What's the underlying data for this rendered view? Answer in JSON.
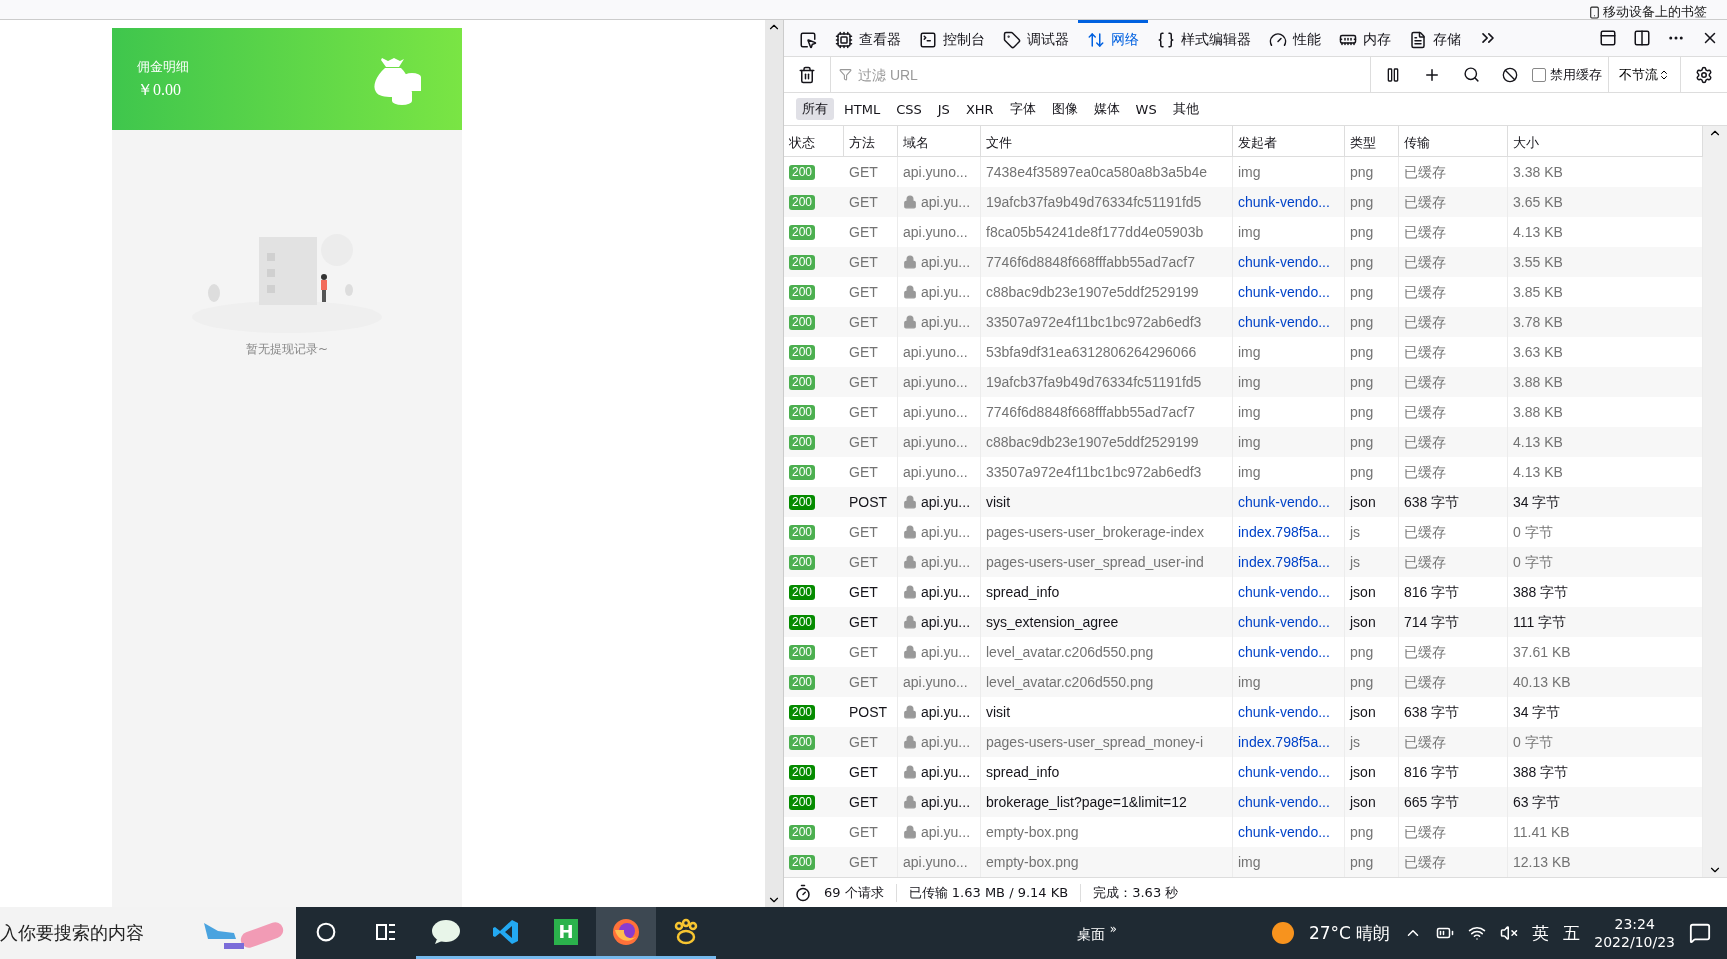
{
  "bookmarks_bar": {
    "label": "移动设备上的书签"
  },
  "mobile_page": {
    "header": {
      "title": "佣金明细",
      "amount": "￥0.00"
    },
    "empty_text": "暂无提现记录~"
  },
  "devtools": {
    "tabs": [
      {
        "kind": "picker",
        "selected": false
      },
      {
        "kind": "inspector",
        "label": "查看器",
        "selected": false
      },
      {
        "kind": "console",
        "label": "控制台",
        "selected": false
      },
      {
        "kind": "debugger",
        "label": "调试器",
        "selected": false
      },
      {
        "kind": "network",
        "label": "网络",
        "selected": true
      },
      {
        "kind": "style",
        "label": "样式编辑器",
        "selected": false
      },
      {
        "kind": "performance",
        "label": "性能",
        "selected": false
      },
      {
        "kind": "memory",
        "label": "内存",
        "selected": false
      },
      {
        "kind": "storage",
        "label": "存储",
        "selected": false
      }
    ],
    "filter": {
      "placeholder": "过滤 URL"
    },
    "disable_cache": {
      "label": "禁用缓存",
      "checked": false
    },
    "throttle": "不节流",
    "type_filters": [
      {
        "label": "所有",
        "selected": true
      },
      {
        "label": "HTML",
        "selected": false
      },
      {
        "label": "CSS",
        "selected": false
      },
      {
        "label": "JS",
        "selected": false
      },
      {
        "label": "XHR",
        "selected": false
      },
      {
        "label": "字体",
        "selected": false
      },
      {
        "label": "图像",
        "selected": false
      },
      {
        "label": "媒体",
        "selected": false
      },
      {
        "label": "WS",
        "selected": false
      },
      {
        "label": "其他",
        "selected": false
      }
    ],
    "columns": [
      "状态",
      "方法",
      "域名",
      "文件",
      "发起者",
      "类型",
      "传输",
      "大小"
    ],
    "rows": [
      {
        "status": "200",
        "method": "GET",
        "secure": false,
        "domain": "api.yuno...",
        "file": "7438e4f35897ea0ca580a8b3a5b4e",
        "initiator": "img",
        "initiator_link": false,
        "type": "png",
        "transfer": "已缓存",
        "size": "3.38 KB",
        "cached": true
      },
      {
        "status": "200",
        "method": "GET",
        "secure": true,
        "domain": "api.yu...",
        "file": "19afcb37fa9b49d76334fc51191fd5",
        "initiator": "chunk-vendo...",
        "initiator_link": true,
        "type": "png",
        "transfer": "已缓存",
        "size": "3.65 KB",
        "cached": true
      },
      {
        "status": "200",
        "method": "GET",
        "secure": false,
        "domain": "api.yuno...",
        "file": "f8ca05b54241de8f177dd4e05903b",
        "initiator": "img",
        "initiator_link": false,
        "type": "png",
        "transfer": "已缓存",
        "size": "4.13 KB",
        "cached": true
      },
      {
        "status": "200",
        "method": "GET",
        "secure": true,
        "domain": "api.yu...",
        "file": "7746f6d8848f668fffabb55ad7acf7",
        "initiator": "chunk-vendo...",
        "initiator_link": true,
        "type": "png",
        "transfer": "已缓存",
        "size": "3.55 KB",
        "cached": true
      },
      {
        "status": "200",
        "method": "GET",
        "secure": true,
        "domain": "api.yu...",
        "file": "c88bac9db23e1907e5ddf2529199",
        "initiator": "chunk-vendo...",
        "initiator_link": true,
        "type": "png",
        "transfer": "已缓存",
        "size": "3.85 KB",
        "cached": true
      },
      {
        "status": "200",
        "method": "GET",
        "secure": true,
        "domain": "api.yu...",
        "file": "33507a972e4f11bc1bc972ab6edf3",
        "initiator": "chunk-vendo...",
        "initiator_link": true,
        "type": "png",
        "transfer": "已缓存",
        "size": "3.78 KB",
        "cached": true
      },
      {
        "status": "200",
        "method": "GET",
        "secure": false,
        "domain": "api.yuno...",
        "file": "53bfa9df31ea6312806264296066",
        "initiator": "img",
        "initiator_link": false,
        "type": "png",
        "transfer": "已缓存",
        "size": "3.63 KB",
        "cached": true
      },
      {
        "status": "200",
        "method": "GET",
        "secure": false,
        "domain": "api.yuno...",
        "file": "19afcb37fa9b49d76334fc51191fd5",
        "initiator": "img",
        "initiator_link": false,
        "type": "png",
        "transfer": "已缓存",
        "size": "3.88 KB",
        "cached": true
      },
      {
        "status": "200",
        "method": "GET",
        "secure": false,
        "domain": "api.yuno...",
        "file": "7746f6d8848f668fffabb55ad7acf7",
        "initiator": "img",
        "initiator_link": false,
        "type": "png",
        "transfer": "已缓存",
        "size": "3.88 KB",
        "cached": true
      },
      {
        "status": "200",
        "method": "GET",
        "secure": false,
        "domain": "api.yuno...",
        "file": "c88bac9db23e1907e5ddf2529199",
        "initiator": "img",
        "initiator_link": false,
        "type": "png",
        "transfer": "已缓存",
        "size": "4.13 KB",
        "cached": true
      },
      {
        "status": "200",
        "method": "GET",
        "secure": false,
        "domain": "api.yuno...",
        "file": "33507a972e4f11bc1bc972ab6edf3",
        "initiator": "img",
        "initiator_link": false,
        "type": "png",
        "transfer": "已缓存",
        "size": "4.13 KB",
        "cached": true
      },
      {
        "status": "200",
        "method": "POST",
        "secure": true,
        "domain": "api.yu...",
        "file": "visit",
        "initiator": "chunk-vendo...",
        "initiator_link": true,
        "type": "json",
        "transfer": "638 字节",
        "size": "34 字节",
        "cached": false
      },
      {
        "status": "200",
        "method": "GET",
        "secure": true,
        "domain": "api.yu...",
        "file": "pages-users-user_brokerage-index",
        "initiator": "index.798f5a...",
        "initiator_link": true,
        "type": "js",
        "transfer": "已缓存",
        "size": "0 字节",
        "cached": true
      },
      {
        "status": "200",
        "method": "GET",
        "secure": true,
        "domain": "api.yu...",
        "file": "pages-users-user_spread_user-ind",
        "initiator": "index.798f5a...",
        "initiator_link": true,
        "type": "js",
        "transfer": "已缓存",
        "size": "0 字节",
        "cached": true
      },
      {
        "status": "200",
        "method": "GET",
        "secure": true,
        "domain": "api.yu...",
        "file": "spread_info",
        "initiator": "chunk-vendo...",
        "initiator_link": true,
        "type": "json",
        "transfer": "816 字节",
        "size": "388 字节",
        "cached": false
      },
      {
        "status": "200",
        "method": "GET",
        "secure": true,
        "domain": "api.yu...",
        "file": "sys_extension_agree",
        "initiator": "chunk-vendo...",
        "initiator_link": true,
        "type": "json",
        "transfer": "714 字节",
        "size": "111 字节",
        "cached": false
      },
      {
        "status": "200",
        "method": "GET",
        "secure": true,
        "domain": "api.yu...",
        "file": "level_avatar.c206d550.png",
        "initiator": "chunk-vendo...",
        "initiator_link": true,
        "type": "png",
        "transfer": "已缓存",
        "size": "37.61 KB",
        "cached": true
      },
      {
        "status": "200",
        "method": "GET",
        "secure": false,
        "domain": "api.yuno...",
        "file": "level_avatar.c206d550.png",
        "initiator": "img",
        "initiator_link": false,
        "type": "png",
        "transfer": "已缓存",
        "size": "40.13 KB",
        "cached": true
      },
      {
        "status": "200",
        "method": "POST",
        "secure": true,
        "domain": "api.yu...",
        "file": "visit",
        "initiator": "chunk-vendo...",
        "initiator_link": true,
        "type": "json",
        "transfer": "638 字节",
        "size": "34 字节",
        "cached": false
      },
      {
        "status": "200",
        "method": "GET",
        "secure": true,
        "domain": "api.yu...",
        "file": "pages-users-user_spread_money-i",
        "initiator": "index.798f5a...",
        "initiator_link": true,
        "type": "js",
        "transfer": "已缓存",
        "size": "0 字节",
        "cached": true
      },
      {
        "status": "200",
        "method": "GET",
        "secure": true,
        "domain": "api.yu...",
        "file": "spread_info",
        "initiator": "chunk-vendo...",
        "initiator_link": true,
        "type": "json",
        "transfer": "816 字节",
        "size": "388 字节",
        "cached": false
      },
      {
        "status": "200",
        "method": "GET",
        "secure": true,
        "domain": "api.yu...",
        "file": "brokerage_list?page=1&limit=12",
        "initiator": "chunk-vendo...",
        "initiator_link": true,
        "type": "json",
        "transfer": "665 字节",
        "size": "63 字节",
        "cached": false
      },
      {
        "status": "200",
        "method": "GET",
        "secure": true,
        "domain": "api.yu...",
        "file": "empty-box.png",
        "initiator": "chunk-vendo...",
        "initiator_link": true,
        "type": "png",
        "transfer": "已缓存",
        "size": "11.41 KB",
        "cached": true
      },
      {
        "status": "200",
        "method": "GET",
        "secure": false,
        "domain": "api.yuno...",
        "file": "empty-box.png",
        "initiator": "img",
        "initiator_link": false,
        "type": "png",
        "transfer": "已缓存",
        "size": "12.13 KB",
        "cached": true
      }
    ],
    "status_bar": {
      "requests": "69 个请求",
      "transferred": "已传输 1.63 MB / 9.14 KB",
      "finished": "完成：3.63 秒"
    }
  },
  "taskbar": {
    "search_text": "入你要搜索的内容",
    "apps": [
      {
        "kind": "cortana",
        "open": false,
        "selected": false
      },
      {
        "kind": "taskview",
        "open": false,
        "selected": false
      },
      {
        "kind": "chat",
        "open": true,
        "selected": false
      },
      {
        "kind": "vscode",
        "open": true,
        "selected": false
      },
      {
        "kind": "hbuilder",
        "label": "H",
        "open": true,
        "selected": false
      },
      {
        "kind": "firefox",
        "open": true,
        "selected": true
      },
      {
        "kind": "paw",
        "open": true,
        "selected": false
      }
    ],
    "desktop": "桌面",
    "desktop_more": "»",
    "weather": "27°C 晴朗",
    "ime": "英",
    "ime_mode": "五",
    "time": "23:24",
    "date": "2022/10/23"
  }
}
